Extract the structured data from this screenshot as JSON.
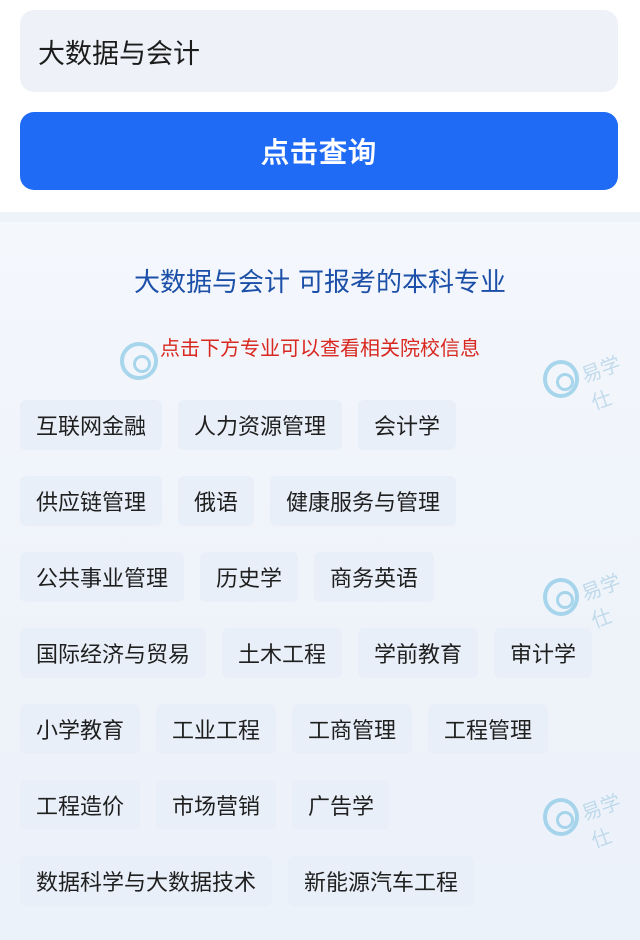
{
  "search": {
    "value": "大数据与会计"
  },
  "query_button": {
    "label": "点击查询"
  },
  "result": {
    "major_name": "大数据与会计",
    "title_suffix": "可报考的本科专业",
    "hint": "点击下方专业可以查看相关院校信息"
  },
  "majors": [
    [
      "互联网金融",
      "人力资源管理",
      "会计学"
    ],
    [
      "供应链管理",
      "俄语",
      "健康服务与管理"
    ],
    [
      "公共事业管理",
      "历史学",
      "商务英语"
    ],
    [
      "国际经济与贸易",
      "土木工程",
      "学前教育",
      "审计学"
    ],
    [
      "小学教育",
      "工业工程",
      "工商管理",
      "工程管理"
    ],
    [
      "工程造价",
      "市场营销",
      "广告学"
    ],
    [
      "数据科学与大数据技术",
      "新能源汽车工程"
    ]
  ],
  "watermark": {
    "text": "易学仕"
  }
}
